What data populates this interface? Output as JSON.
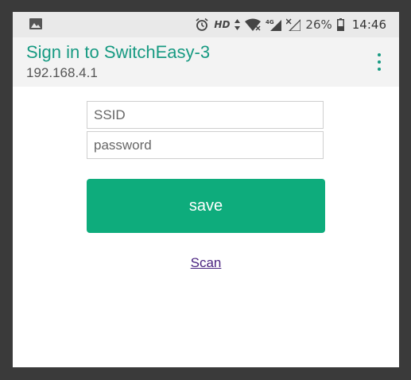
{
  "status_bar": {
    "network_label": "HD",
    "mobile_data_label": "4G",
    "battery_percent": "26%",
    "time": "14:46"
  },
  "app_bar": {
    "title": "Sign in to SwitchEasy-3",
    "subtitle": "192.168.4.1"
  },
  "form": {
    "ssid_placeholder": "SSID",
    "ssid_value": "",
    "password_placeholder": "password",
    "password_value": "",
    "save_label": "save",
    "scan_label": "Scan"
  },
  "colors": {
    "accent": "#179a82",
    "button": "#0eac7c",
    "link": "#4a2380"
  },
  "icons": [
    "image-icon",
    "alarm-icon",
    "data-arrows-icon",
    "wifi-icon",
    "signal-icon",
    "no-signal-icon",
    "battery-icon",
    "overflow-menu-icon"
  ]
}
